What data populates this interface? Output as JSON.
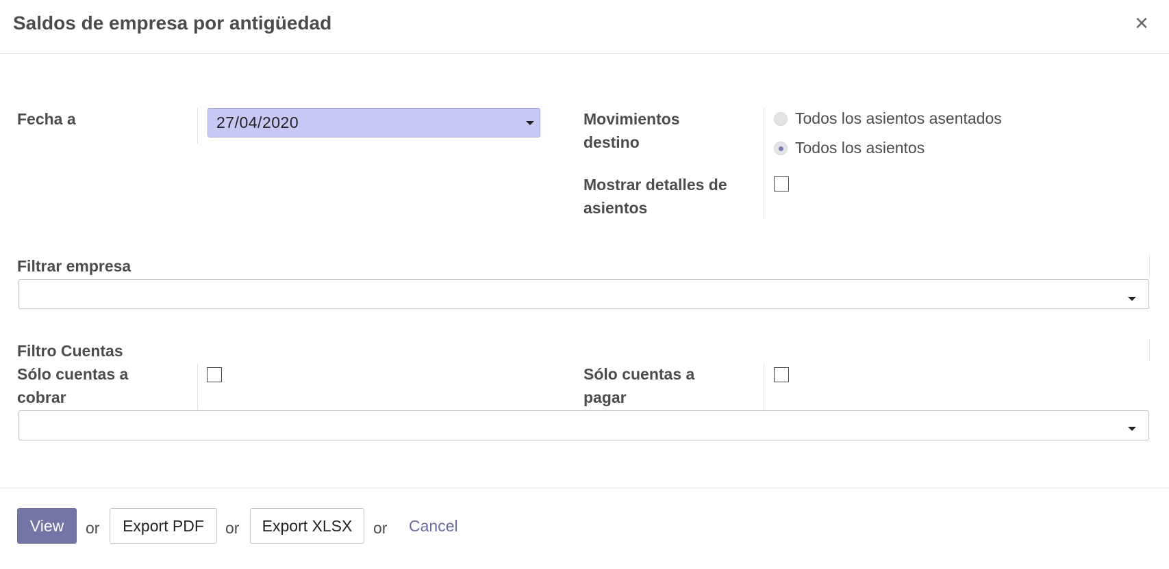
{
  "dialog": {
    "title": "Saldos de empresa por antigüedad",
    "close_symbol": "×"
  },
  "form": {
    "fecha": {
      "label": "Fecha a",
      "value": "27/04/2020"
    },
    "movimientos": {
      "label_line1": "Movimientos",
      "label_line2": "destino",
      "options": [
        {
          "label": "Todos los asientos asentados",
          "selected": false
        },
        {
          "label": "Todos los asientos",
          "selected": true
        }
      ]
    },
    "mostrar_detalles": {
      "label_line1": "Mostrar detalles de",
      "label_line2": "asientos",
      "checked": false
    },
    "filtrar_empresa": {
      "label": "Filtrar empresa",
      "value": ""
    },
    "filtro_cuentas": {
      "label": "Filtro Cuentas",
      "cobrar": {
        "label_line1": "Sólo cuentas a",
        "label_line2": "cobrar",
        "checked": false
      },
      "pagar": {
        "label_line1": "Sólo cuentas a",
        "label_line2": "pagar",
        "checked": false
      },
      "value": ""
    }
  },
  "footer": {
    "view_label": "View",
    "export_pdf_label": "Export PDF",
    "export_xlsx_label": "Export XLSX",
    "cancel_label": "Cancel",
    "or_text": "or"
  },
  "colors": {
    "primary": "#7474a6",
    "date_highlight": "#c8c8f5",
    "link": "#6a6aa0"
  },
  "icons": [
    "close-icon",
    "caret-down-icon"
  ]
}
